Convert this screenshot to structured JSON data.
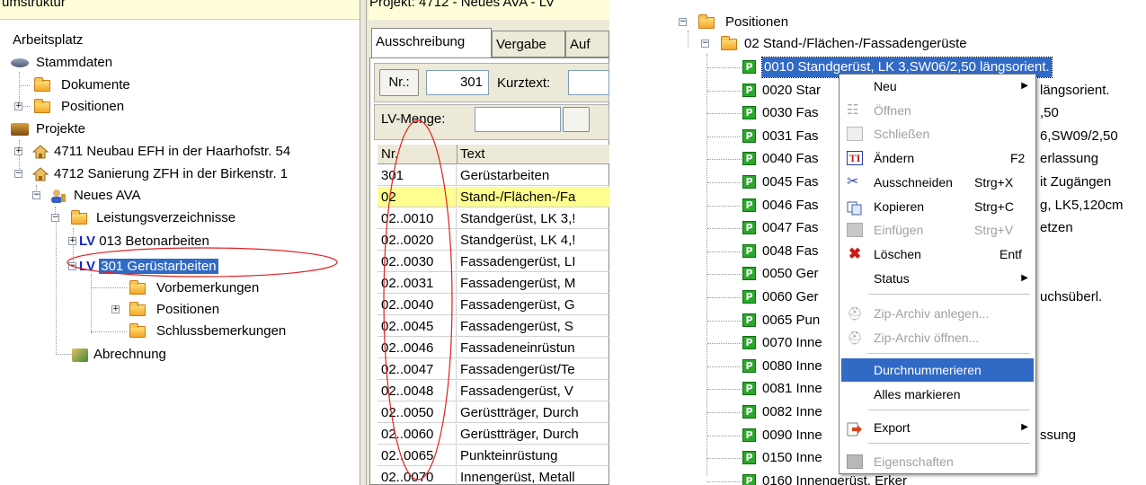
{
  "left_tree": {
    "header": "umstruktur",
    "nodes": [
      {
        "label": "Arbeitsplatz"
      },
      {
        "label": "Stammdaten"
      },
      {
        "label": "Dokumente"
      },
      {
        "label": "Positionen"
      },
      {
        "label": "Projekte"
      },
      {
        "label": "4711 Neubau EFH in der Haarhofstr. 54"
      },
      {
        "label": "4712 Sanierung ZFH in der Birkenstr. 1"
      },
      {
        "label": "Neues AVA"
      },
      {
        "label": "Leistungsverzeichnisse"
      },
      {
        "tag": "LV",
        "label": "013 Betonarbeiten"
      },
      {
        "tag": "LV",
        "label": "301 Gerüstarbeiten"
      },
      {
        "label": "Vorbemerkungen"
      },
      {
        "label": "Positionen"
      },
      {
        "label": "Schlussbemerkungen"
      },
      {
        "label": "Abrechnung"
      }
    ]
  },
  "middle": {
    "project_title": "Projekt: 4712 - Neues AVA - LV",
    "tabs": [
      "Ausschreibung",
      "Vergabe",
      "Auf"
    ],
    "nr_button": "Nr.:",
    "nr_value": "301",
    "kurztext_label": "Kurztext:",
    "lv_menge_label": "LV-Menge:",
    "grid_headers": [
      "Nr.",
      "Text"
    ],
    "rows": [
      {
        "nr": "301",
        "text": "Gerüstarbeiten",
        "highlight": false
      },
      {
        "nr": "02",
        "text": "Stand-/Flächen-/Fa",
        "highlight": true
      },
      {
        "nr": "02..0010",
        "text": "Standgerüst, LK 3,!",
        "highlight": false
      },
      {
        "nr": "02..0020",
        "text": "Standgerüst, LK 4,!",
        "highlight": false
      },
      {
        "nr": "02..0030",
        "text": "Fassadengerüst, LI",
        "highlight": false
      },
      {
        "nr": "02..0031",
        "text": "Fassadengerüst, M",
        "highlight": false
      },
      {
        "nr": "02..0040",
        "text": "Fassadengerüst, G",
        "highlight": false
      },
      {
        "nr": "02..0045",
        "text": "Fassadengerüst, S",
        "highlight": false
      },
      {
        "nr": "02..0046",
        "text": "Fassadeneinrüstun",
        "highlight": false
      },
      {
        "nr": "02..0047",
        "text": "Fassadengerüst/Te",
        "highlight": false
      },
      {
        "nr": "02..0048",
        "text": "Fassadengerüst, V",
        "highlight": false
      },
      {
        "nr": "02..0050",
        "text": "Gerüstträger, Durch",
        "highlight": false
      },
      {
        "nr": "02..0060",
        "text": "Gerüstträger, Durch",
        "highlight": false
      },
      {
        "nr": "02..0065",
        "text": "Punkteinrüstung",
        "highlight": false
      },
      {
        "nr": "02..0070",
        "text": "Innengerüst, Metall",
        "highlight": false
      }
    ]
  },
  "right_tree": {
    "root": "Positionen",
    "group": "02 Stand-/Flächen-/Fassadengerüste",
    "positions": [
      {
        "left": "0010 Standgerüst, LK 3,SW06/2,50 längsorient.",
        "right": "",
        "selected": true
      },
      {
        "left": "0020 Star",
        "right": "längsorient."
      },
      {
        "left": "0030 Fas",
        "right": ",50"
      },
      {
        "left": "0031 Fas",
        "right": "6,SW09/2,50"
      },
      {
        "left": "0040 Fas",
        "right": "erlassung"
      },
      {
        "left": "0045 Fas",
        "right": "it Zugängen"
      },
      {
        "left": "0046 Fas",
        "right": "g, LK5,120cm"
      },
      {
        "left": "0047 Fas",
        "right": "etzen"
      },
      {
        "left": "0048 Fas",
        "right": ""
      },
      {
        "left": "0050 Ger",
        "right": ""
      },
      {
        "left": "0060 Ger",
        "right": "uchsüberl."
      },
      {
        "left": "0065 Pun",
        "right": ""
      },
      {
        "left": "0070 Inne",
        "right": ""
      },
      {
        "left": "0080 Inne",
        "right": ""
      },
      {
        "left": "0081 Inne",
        "right": ""
      },
      {
        "left": "0082 Inne",
        "right": ""
      },
      {
        "left": "0090 Inne",
        "right": "ssung"
      },
      {
        "left": "0150 Inne",
        "right": ""
      },
      {
        "left": "0160 Innengerüst, Erker",
        "right": ""
      }
    ]
  },
  "context_menu": {
    "items": [
      {
        "label": "Neu",
        "shortcut": "",
        "submenu": true,
        "disabled": false
      },
      {
        "label": "Öffnen",
        "shortcut": "",
        "submenu": false,
        "disabled": true
      },
      {
        "label": "Schließen",
        "shortcut": "",
        "submenu": false,
        "disabled": true
      },
      {
        "label": "Ändern",
        "shortcut": "F2",
        "submenu": false,
        "disabled": false
      },
      {
        "label": "Ausschneiden",
        "shortcut": "Strg+X",
        "submenu": false,
        "disabled": false
      },
      {
        "label": "Kopieren",
        "shortcut": "Strg+C",
        "submenu": false,
        "disabled": false
      },
      {
        "label": "Einfügen",
        "shortcut": "Strg+V",
        "submenu": false,
        "disabled": true
      },
      {
        "label": "Löschen",
        "shortcut": "Entf",
        "submenu": false,
        "disabled": false
      },
      {
        "label": "Status",
        "shortcut": "",
        "submenu": true,
        "disabled": false
      },
      {
        "label": "Zip-Archiv anlegen...",
        "shortcut": "",
        "submenu": false,
        "disabled": true
      },
      {
        "label": "Zip-Archiv öffnen...",
        "shortcut": "",
        "submenu": false,
        "disabled": true
      },
      {
        "label": "Durchnummerieren",
        "shortcut": "",
        "submenu": false,
        "disabled": false,
        "highlighted": true
      },
      {
        "label": "Alles markieren",
        "shortcut": "",
        "submenu": false,
        "disabled": false
      },
      {
        "label": "Export",
        "shortcut": "",
        "submenu": true,
        "disabled": false
      },
      {
        "label": "Eigenschaften",
        "shortcut": "",
        "submenu": false,
        "disabled": true
      }
    ],
    "submenu_arrow": "▶"
  },
  "colors": {
    "selection": "#316ac5",
    "highlight_row": "#ffff90",
    "annotation_red": "#e02020",
    "position_icon": "#2aa82a"
  }
}
